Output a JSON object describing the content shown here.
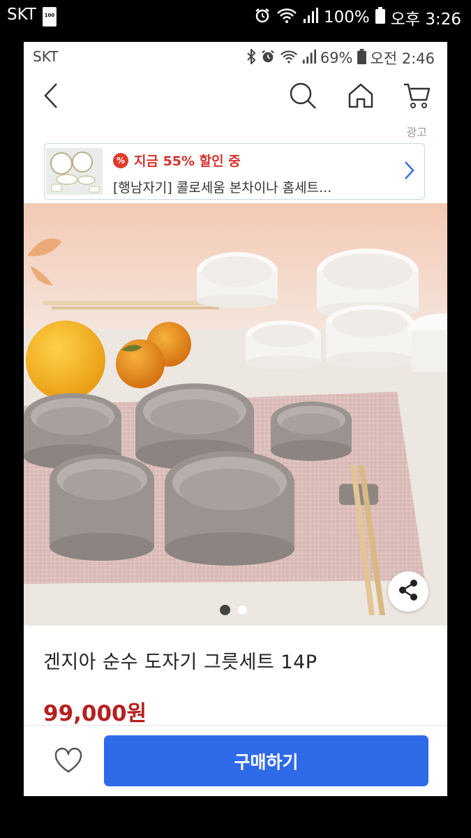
{
  "outer_status": {
    "carrier": "SKT",
    "sim_label": "100",
    "battery": "100%",
    "time": "오후 3:26"
  },
  "inner_status": {
    "carrier": "SKT",
    "battery": "69%",
    "time": "오전 2:46"
  },
  "appbar": {
    "icons": [
      "back-icon",
      "search-icon",
      "home-icon",
      "cart-icon"
    ]
  },
  "ad": {
    "label": "광고",
    "badge": "%",
    "discount_text": "지금 55% 할인 중",
    "title": "[행남자기] 콜로세움 본차이나 홈세트..."
  },
  "hero": {
    "carousel_total": 2,
    "carousel_active": 1
  },
  "product": {
    "name": "겐지아 순수 도자기 그릇세트 14P",
    "price": "99,000원"
  },
  "bottom": {
    "buy_label": "구매하기"
  },
  "colors": {
    "accent": "#2f6ae9",
    "price": "#b5201e",
    "discount": "#d4332d"
  }
}
